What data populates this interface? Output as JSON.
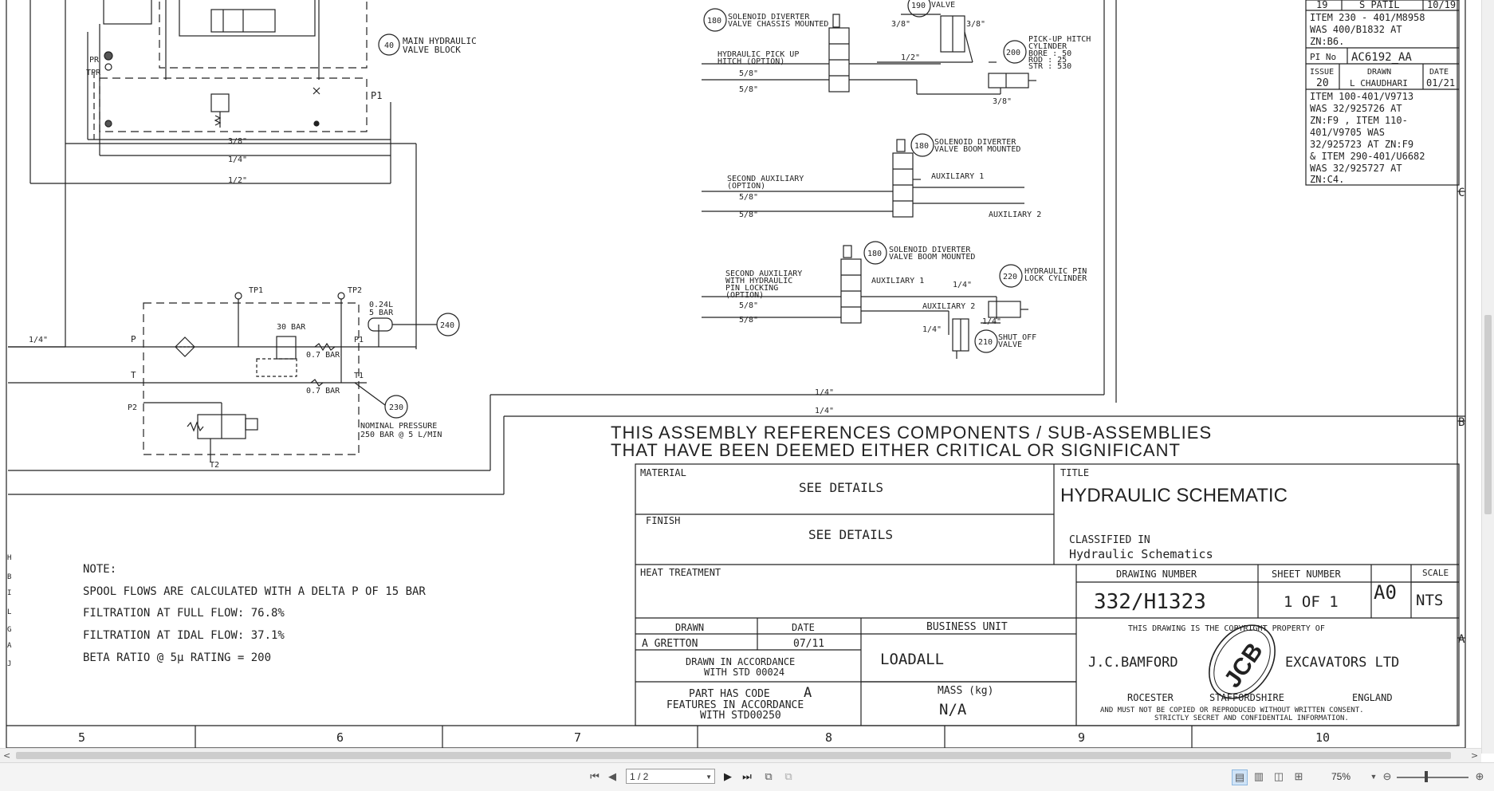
{
  "schematic": {
    "left": {
      "tag40": "40",
      "main_block": "MAIN HYDRAULIC",
      "main_block2": "VALVE BLOCK",
      "pr": "PR",
      "tpr": "TPR",
      "p1": "P1",
      "line_38": "3/8\"",
      "line_14": "1/4\"",
      "line_12": "1/2\"",
      "tp1": "TP1",
      "tp2": "TP2",
      "acc1": "0.24L",
      "acc2": "5 BAR",
      "tag240": "240",
      "in_14": "1/4\"",
      "port_p": "P",
      "port_t": "T",
      "port_p1": "P1",
      "port_t1": "T1",
      "bar30": "30 BAR",
      "bar07a": "0.7 BAR",
      "bar07b": "0.7 BAR",
      "tag230": "230",
      "nominal1": "NOMINAL PRESSURE",
      "nominal2": "250 BAR @ 5 L/MIN",
      "port_p2": "P2",
      "port_t2": "T2"
    },
    "diverters": {
      "tag190": "190",
      "valve_lbl": "VALVE",
      "tag180a": "180",
      "d1_l1": "SOLENOID DIVERTER",
      "d1_l2": "VALVE CHASSIS MOUNTED",
      "pickup1": "HYDRAULIC PICK UP",
      "pickup2": "HITCH (OPTION)",
      "tag200": "200",
      "cyl1": "PICK-UP HITCH",
      "cyl2": "CYLINDER",
      "bore": "BORE : 50",
      "rod": "ROD : 25",
      "str": "STR : 530",
      "s38a": "3/8\"",
      "s38b": "3/8\"",
      "s38c": "3/8\"",
      "s12": "1/2\"",
      "s58a": "5/8\"",
      "s58b": "5/8\"",
      "tag180b": "180",
      "d2_l1": "SOLENOID DIVERTER",
      "d2_l2": "VALVE BOOM MOUNTED",
      "sec1": "SECOND AUXILIARY",
      "sec2": "(OPTION)",
      "aux1": "AUXILIARY 1",
      "aux2": "AUXILIARY 2",
      "s58c": "5/8\"",
      "s58d": "5/8\"",
      "tag180c": "180",
      "d3_l1": "SOLENOID DIVERTER",
      "d3_l2": "VALVE BOOM MOUNTED",
      "sec3": "SECOND AUXILIARY",
      "sec4": "WITH HYDRAULIC",
      "sec5": "PIN LOCKING",
      "sec6": "(OPTION)",
      "aux3": "AUXILIARY 1",
      "aux4": "AUXILIARY 2",
      "tag220": "220",
      "pin1": "HYDRAULIC PIN",
      "pin2": "LOCK CYLINDER",
      "tag210": "210",
      "shut1": "SHUT OFF",
      "shut2": "VALVE",
      "s14a": "1/4\"",
      "s14b": "1/4\"",
      "s14c": "1/4\"",
      "s58e": "5/8\"",
      "s58f": "5/8\"",
      "bot14a": "1/4\"",
      "bot14b": "1/4\""
    },
    "notice1": "THIS ASSEMBLY REFERENCES COMPONENTS / SUB-ASSEMBLIES",
    "notice2": "THAT HAVE BEEN DEEMED EITHER CRITICAL OR SIGNIFICANT",
    "notes": {
      "title": "NOTE:",
      "l1": "SPOOL FLOWS ARE CALCULATED WITH A DELTA P OF 15 BAR",
      "l2": "FILTRATION AT FULL FLOW: 76.8%",
      "l3": "FILTRATION AT IDAL FLOW: 37.1%",
      "l4": "BETA RATIO @ 5μ RATING = 200"
    },
    "zone_letters": [
      "H",
      "B",
      "I",
      "L",
      "G",
      "A",
      "J"
    ],
    "revision": {
      "r1a": "19",
      "r1b": "S PATIL",
      "r1c": "10/19",
      "t1": "ITEM 230 - 401/M8958",
      "t2": "WAS 400/B1832 AT",
      "t3": "ZN:B6.",
      "pi_label": "PI No",
      "pi_value": "AC6192_AA",
      "issue_h": "ISSUE",
      "drawn_h": "DRAWN",
      "date_h": "DATE",
      "issue_v": "20",
      "drawn_v": "L CHAUDHARI",
      "date_v": "01/21",
      "c1": "ITEM 100-401/V9713",
      "c2": "WAS 32/925726 AT",
      "c3": "ZN:F9 , ITEM 110-",
      "c4": "401/V9705 WAS",
      "c5": "32/925723 AT ZN:F9",
      "c6": "& ITEM 290-401/U6682",
      "c7": "WAS 32/925727 AT",
      "c8": "ZN:C4."
    },
    "right_zones": [
      "C",
      "B",
      "A"
    ],
    "bottom_zones": [
      "5",
      "6",
      "7",
      "8",
      "9",
      "10"
    ]
  },
  "title_block": {
    "material_label": "MATERIAL",
    "material_value": "SEE DETAILS",
    "finish_label": "FINISH",
    "finish_value": "SEE DETAILS",
    "title_label": "TITLE",
    "title_value": "HYDRAULIC SCHEMATIC",
    "classified_label": "CLASSIFIED IN",
    "classified_value": "Hydraulic Schematics",
    "heat_label": "HEAT TREATMENT",
    "drawing_number_label": "DRAWING NUMBER",
    "drawing_number": "332/H1323",
    "sheet_label": "SHEET NUMBER",
    "sheet_value": "1 OF 1",
    "size": "A0",
    "scale_label": "SCALE",
    "scale_value": "NTS",
    "drawn_label": "DRAWN",
    "drawn_value": "A GRETTON",
    "date_label": "DATE",
    "date_value": "07/11",
    "accord1": "DRAWN IN ACCORDANCE",
    "accord2": "WITH STD 00024",
    "part1": "PART HAS CODE",
    "part_code": "A",
    "part2": "FEATURES IN ACCORDANCE",
    "part3": "WITH STD00250",
    "bu_label": "BUSINESS UNIT",
    "bu_value": "LOADALL",
    "mass_label": "MASS (kg)",
    "mass_value": "N/A",
    "copy_line": "THIS DRAWING IS THE COPYRIGHT PROPERTY OF",
    "company_left": "J.C.BAMFORD",
    "company_right": "EXCAVATORS LTD",
    "logo": "JCB",
    "city": "ROCESTER",
    "county": "STAFFORDSHIRE",
    "country": "ENGLAND",
    "legal1": "AND MUST NOT BE COPIED OR REPRODUCED WITHOUT WRITTEN CONSENT.",
    "legal2": "STRICTLY SECRET AND CONFIDENTIAL INFORMATION."
  },
  "viewer": {
    "page_value": "1 / 2",
    "zoom": "75%",
    "hscroll_left": "<",
    "hscroll_right": ">"
  }
}
